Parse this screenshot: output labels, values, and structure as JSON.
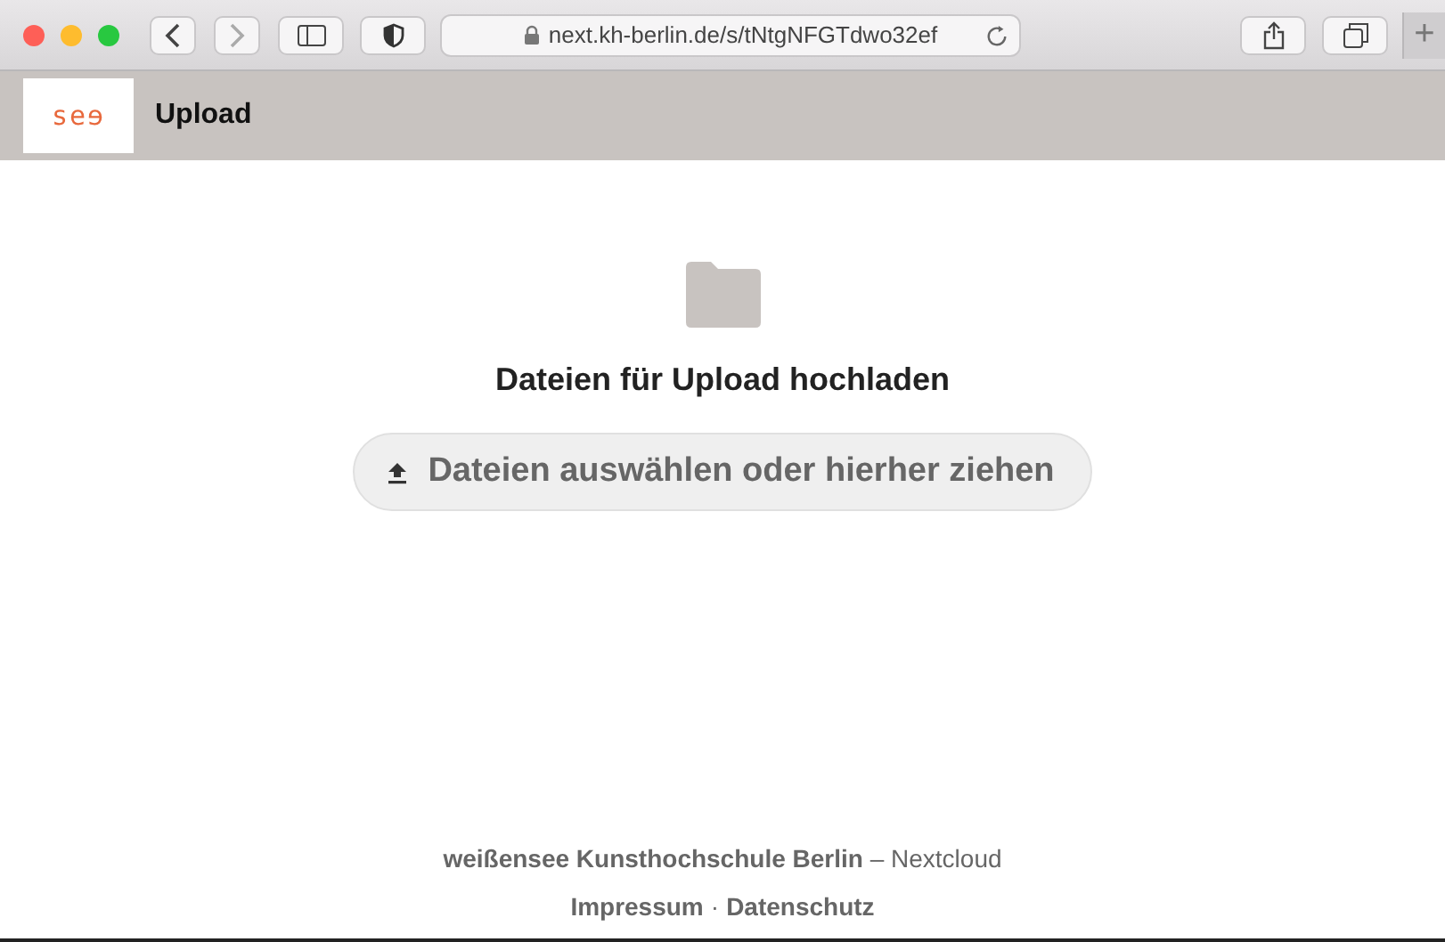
{
  "browser": {
    "url": "next.kh-berlin.de/s/tNtgNFGTdwo32ef",
    "new_tab": "+"
  },
  "header": {
    "logo": "seɘ",
    "title": "Upload"
  },
  "upload": {
    "heading": "Dateien für Upload hochladen",
    "button": "Dateien auswählen oder hierher ziehen"
  },
  "footer": {
    "text": "**weißensee Kunsthochschule Berlin** – Nextcloud",
    "links": [
      "Impressum",
      "Datenschutz"
    ],
    "separator": "·"
  }
}
